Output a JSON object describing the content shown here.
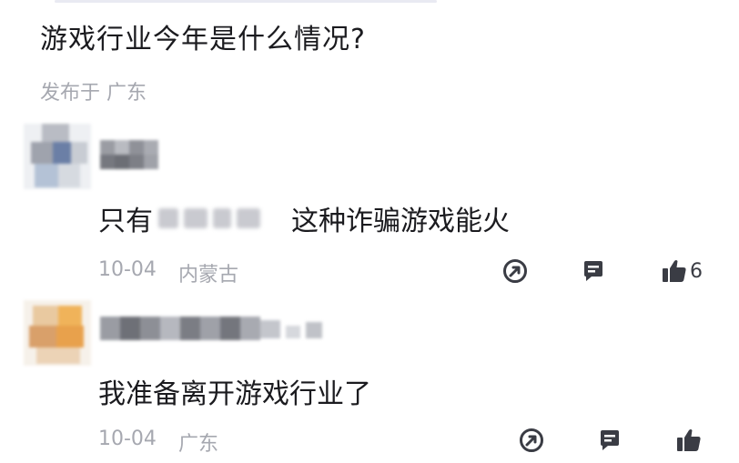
{
  "post": {
    "title": "游戏行业今年是什么情况?",
    "location": "发布于 广东"
  },
  "comments": [
    {
      "text_before": "只有",
      "text_after": "这种诈骗游戏能火",
      "text_redacted": true,
      "date": "10-04",
      "location": "内蒙古",
      "like_count": "6"
    },
    {
      "text": "我准备离开游戏行业了",
      "date": "10-04",
      "location": "广东",
      "like_count": ""
    }
  ],
  "icons": {
    "share": "share-icon",
    "reply": "reply-icon",
    "like": "thumbs-up-icon"
  },
  "colors": {
    "text": "#1b1b1f",
    "secondary": "#a6a8b0",
    "icon": "#3a3c44"
  }
}
